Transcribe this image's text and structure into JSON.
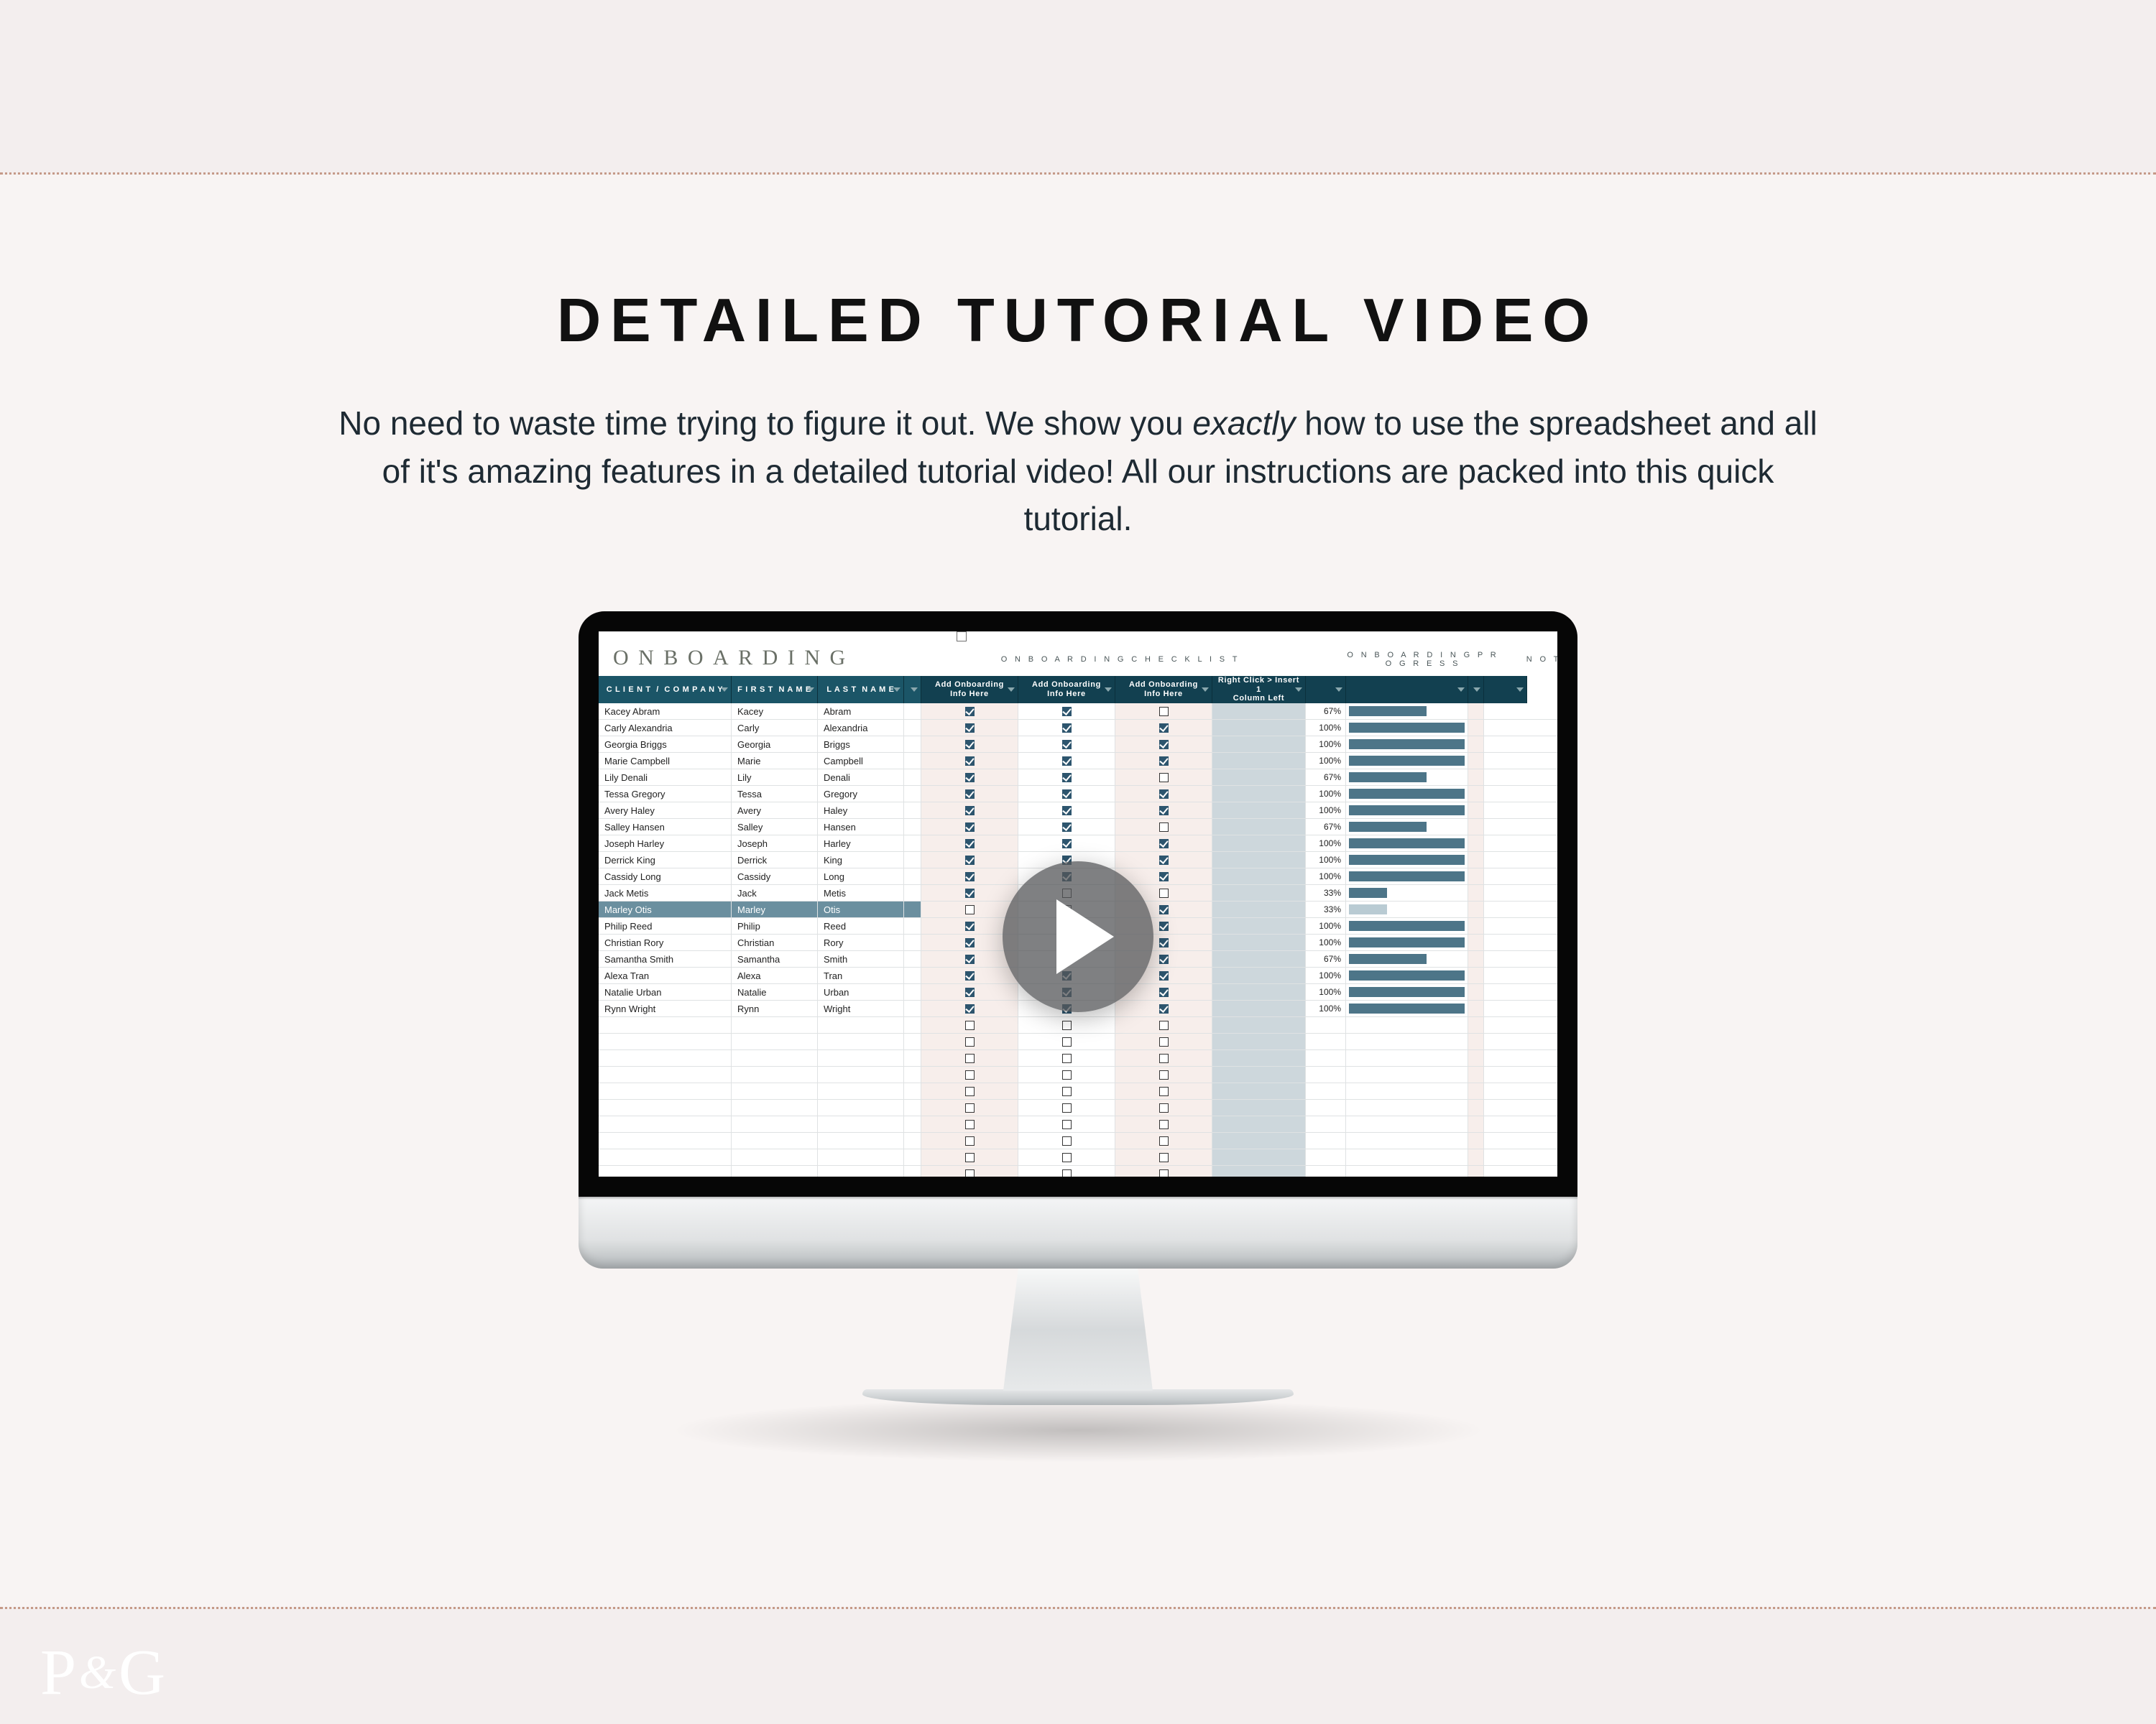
{
  "heading": "DETAILED TUTORIAL VIDEO",
  "subtext_before": "No need to waste time trying to figure it out. We show you ",
  "subtext_em": "exactly",
  "subtext_after": " how to use the spreadsheet and all of it's amazing features in a detailed tutorial video! All our instructions are packed into this quick tutorial.",
  "logo_1": "P",
  "logo_amp": "&",
  "logo_2": "G",
  "sheet": {
    "title": "ONBOARDING",
    "sections": {
      "checklist": "O N B O A R D I N G   C H E C K L I S T",
      "progress": "O N B O A R D I N G   P R O G R E S S",
      "not": "N O T"
    },
    "headers": {
      "client": "C L I E N T  /  C O M P A N Y",
      "first": "F I R S T  N A M E",
      "last": "L A S T  N A M E",
      "info1": "Add Onboarding\nInfo Here",
      "info2": "Add Onboarding\nInfo Here",
      "info3": "Add Onboarding\nInfo Here",
      "insert": "Right Click > Insert 1\nColumn Left"
    },
    "rows": [
      {
        "client": "Kacey Abram",
        "first": "Kacey",
        "last": "Abram",
        "c1": 1,
        "c2": 1,
        "c3": 0,
        "pct": "67%",
        "bar": 67
      },
      {
        "client": "Carly Alexandria",
        "first": "Carly",
        "last": "Alexandria",
        "c1": 1,
        "c2": 1,
        "c3": 1,
        "pct": "100%",
        "bar": 100
      },
      {
        "client": "Georgia Briggs",
        "first": "Georgia",
        "last": "Briggs",
        "c1": 1,
        "c2": 1,
        "c3": 1,
        "pct": "100%",
        "bar": 100
      },
      {
        "client": "Marie Campbell",
        "first": "Marie",
        "last": "Campbell",
        "c1": 1,
        "c2": 1,
        "c3": 1,
        "pct": "100%",
        "bar": 100
      },
      {
        "client": "Lily Denali",
        "first": "Lily",
        "last": "Denali",
        "c1": 1,
        "c2": 1,
        "c3": 0,
        "pct": "67%",
        "bar": 67
      },
      {
        "client": "Tessa Gregory",
        "first": "Tessa",
        "last": "Gregory",
        "c1": 1,
        "c2": 1,
        "c3": 1,
        "pct": "100%",
        "bar": 100
      },
      {
        "client": "Avery Haley",
        "first": "Avery",
        "last": "Haley",
        "c1": 1,
        "c2": 1,
        "c3": 1,
        "pct": "100%",
        "bar": 100
      },
      {
        "client": "Salley Hansen",
        "first": "Salley",
        "last": "Hansen",
        "c1": 1,
        "c2": 1,
        "c3": 0,
        "pct": "67%",
        "bar": 67
      },
      {
        "client": "Joseph Harley",
        "first": "Joseph",
        "last": "Harley",
        "c1": 1,
        "c2": 1,
        "c3": 1,
        "pct": "100%",
        "bar": 100
      },
      {
        "client": "Derrick King",
        "first": "Derrick",
        "last": "King",
        "c1": 1,
        "c2": 1,
        "c3": 1,
        "pct": "100%",
        "bar": 100
      },
      {
        "client": "Cassidy Long",
        "first": "Cassidy",
        "last": "Long",
        "c1": 1,
        "c2": 1,
        "c3": 1,
        "pct": "100%",
        "bar": 100
      },
      {
        "client": "Jack Metis",
        "first": "Jack",
        "last": "Metis",
        "c1": 1,
        "c2": 0,
        "c3": 0,
        "pct": "33%",
        "bar": 33
      },
      {
        "client": "Marley Otis",
        "first": "Marley",
        "last": "Otis",
        "c1": 0,
        "c2": 0,
        "c3": 1,
        "pct": "33%",
        "bar": 33,
        "sel": true,
        "barLight": true
      },
      {
        "client": "Philip Reed",
        "first": "Philip",
        "last": "Reed",
        "c1": 1,
        "c2": 1,
        "c3": 1,
        "pct": "100%",
        "bar": 100
      },
      {
        "client": "Christian Rory",
        "first": "Christian",
        "last": "Rory",
        "c1": 1,
        "c2": 1,
        "c3": 1,
        "pct": "100%",
        "bar": 100
      },
      {
        "client": "Samantha Smith",
        "first": "Samantha",
        "last": "Smith",
        "c1": 1,
        "c2": 0,
        "c3": 1,
        "pct": "67%",
        "bar": 67
      },
      {
        "client": "Alexa Tran",
        "first": "Alexa",
        "last": "Tran",
        "c1": 1,
        "c2": 1,
        "c3": 1,
        "pct": "100%",
        "bar": 100
      },
      {
        "client": "Natalie Urban",
        "first": "Natalie",
        "last": "Urban",
        "c1": 1,
        "c2": 1,
        "c3": 1,
        "pct": "100%",
        "bar": 100
      },
      {
        "client": "Rynn Wright",
        "first": "Rynn",
        "last": "Wright",
        "c1": 1,
        "c2": 1,
        "c3": 1,
        "pct": "100%",
        "bar": 100
      }
    ],
    "empty_rows": 11
  },
  "widths": {
    "client": 185,
    "first": 120,
    "last": 120,
    "m": 24,
    "chk": 135,
    "ins": 130,
    "pct": 56,
    "bar": 170,
    "gap": 22,
    "not": 60
  }
}
